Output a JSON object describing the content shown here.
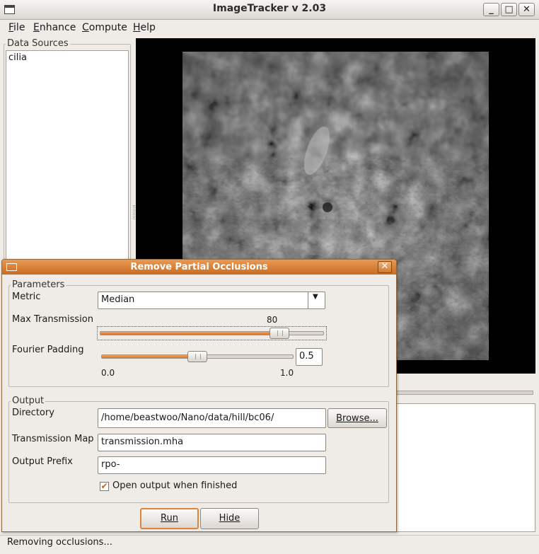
{
  "app": {
    "title": "ImageTracker v 2.03",
    "window_buttons": {
      "minimize": "_",
      "maximize": "□",
      "close": "✕"
    }
  },
  "menu": {
    "items": [
      {
        "label": "File",
        "mnemonic": "F",
        "rest": "ile"
      },
      {
        "label": "Enhance",
        "mnemonic": "E",
        "rest": "nhance"
      },
      {
        "label": "Compute",
        "mnemonic": "C",
        "rest": "ompute"
      },
      {
        "label": "Help",
        "mnemonic": "H",
        "rest": "elp"
      }
    ]
  },
  "data_sources": {
    "legend": "Data Sources",
    "items": [
      "cilia"
    ]
  },
  "dialog": {
    "title": "Remove Partial Occlusions",
    "close": "✕",
    "parameters": {
      "legend": "Parameters",
      "metric_label": "Metric",
      "metric_value": "Median",
      "max_transmission_label": "Max Transmission",
      "max_transmission_value": "80",
      "max_transmission_fraction": 0.8,
      "fourier_padding_label": "Fourier Padding",
      "fourier_padding_value": "0.5",
      "fourier_padding_fraction": 0.5,
      "fourier_min": "0.0",
      "fourier_max": "1.0"
    },
    "output": {
      "legend": "Output",
      "directory_label": "Directory",
      "directory_value": "/home/beastwoo/Nano/data/hill/bc06/",
      "browse_button": "Browse...",
      "transmission_map_label": "Transmission Map",
      "transmission_map_value": "transmission.mha",
      "output_prefix_label": "Output Prefix",
      "output_prefix_value": "rpo-",
      "open_output_label": "Open output when finished",
      "open_output_checked": true
    },
    "run_button": "Run",
    "hide_button": "Hide"
  },
  "status": {
    "text": "Removing occlusions..."
  },
  "colors": {
    "accent": "#e0843a",
    "title_gradient_top": "#e99a53",
    "title_gradient_bottom": "#c96b22"
  }
}
